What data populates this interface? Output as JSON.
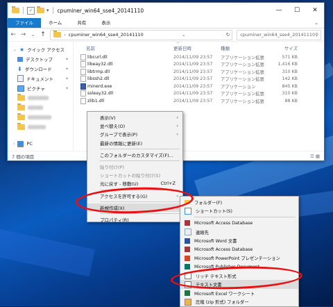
{
  "window": {
    "title": "cpuminer_win64_sse4_20141110",
    "controls": [
      "—",
      "☐",
      "✕"
    ]
  },
  "ribbon": {
    "tabs": [
      "ファイル",
      "ホーム",
      "共有",
      "表示"
    ],
    "expand": "⌄"
  },
  "address": {
    "back": "←",
    "forward": "→",
    "recent": "⌄",
    "up": "↑",
    "path": "cpuminer_win64_sse4_20141110",
    "search_placeholder": "cpuminer_win64_sse4_20141110"
  },
  "sidebar": {
    "quick_access": "クイック アクセス",
    "items": [
      "デスクトップ",
      "ダウンロード",
      "ドキュメント",
      "ピクチャ"
    ],
    "pc": "PC"
  },
  "files": {
    "columns": [
      "名前",
      "更新日時",
      "種類",
      "サイズ"
    ],
    "rows": [
      {
        "name": "libcurl.dll",
        "date": "2014/11/09 23:57",
        "type": "アプリケーション拡張",
        "size": "571 KB"
      },
      {
        "name": "libeay32.dll",
        "date": "2014/11/09 23:57",
        "type": "アプリケーション拡張",
        "size": "1,416 KB"
      },
      {
        "name": "libtrmp.dll",
        "date": "2014/11/09 23:57",
        "type": "アプリケーション拡張",
        "size": "310 KB"
      },
      {
        "name": "libssh2.dll",
        "date": "2014/11/09 23:57",
        "type": "アプリケーション拡張",
        "size": "142 KB"
      },
      {
        "name": "minerd.exe",
        "date": "2014/11/09 23:57",
        "type": "アプリケーション",
        "size": "845 KB"
      },
      {
        "name": "ssleay32.dll",
        "date": "2014/11/09 23:57",
        "type": "アプリケーション拡張",
        "size": "310 KB"
      },
      {
        "name": "zlib1.dll",
        "date": "2014/11/09 23:57",
        "type": "アプリケーション拡張",
        "size": "88 KB"
      }
    ]
  },
  "status": {
    "count": "7 個の項目"
  },
  "context_menu": {
    "view": "表示(V)",
    "sort": "並べ替え(O)",
    "group": "グループで表示(P)",
    "refresh": "最新の情報に更新(E)",
    "customize": "このフォルダーのカスタマイズ(F)...",
    "paste": "貼り付け(P)",
    "paste_shortcut": "ショートカットの貼り付け(S)",
    "undo": "元に戻す - 移動(U)",
    "undo_shortcut": "Ctrl+Z",
    "access": "アクセスを許可する(G)",
    "new": "新規作成(X)",
    "properties": "プロパティ(R)"
  },
  "submenu": {
    "items": [
      "フォルダー(F)",
      "ショートカット(S)",
      "Microsoft Access Database",
      "連絡先",
      "Microsoft Word 文書",
      "Microsoft Access Database",
      "Microsoft PowerPoint プレゼンテーション",
      "Microsoft Publisher Document",
      "リッチ テキスト形式",
      "テキスト文書",
      "Microsoft Excel ワークシート",
      "圧縮 (zip 形式) フォルダー"
    ]
  },
  "colors": {
    "accent": "#1979ca",
    "annotation": "#e81010"
  }
}
